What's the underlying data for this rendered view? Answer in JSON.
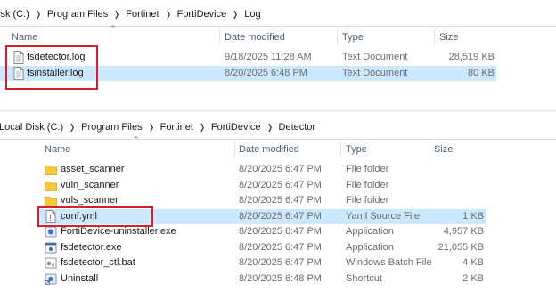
{
  "pane1": {
    "breadcrumb": [
      "isk (C:)",
      "Program Files",
      "Fortinet",
      "FortiDevice",
      "Log"
    ],
    "columns": {
      "name": "Name",
      "date": "Date modified",
      "type": "Type",
      "size": "Size"
    },
    "files": [
      {
        "name": "fsdetector.log",
        "date": "9/18/2025 11:28 AM",
        "type": "Text Document",
        "size": "28,519 KB",
        "icon": "text-file-icon"
      },
      {
        "name": "fsinstaller.log",
        "date": "8/20/2025 6:48 PM",
        "type": "Text Document",
        "size": "80 KB",
        "icon": "text-file-icon"
      }
    ]
  },
  "pane2": {
    "breadcrumb": [
      "Local Disk (C:)",
      "Program Files",
      "Fortinet",
      "FortiDevice",
      "Detector"
    ],
    "columns": {
      "name": "Name",
      "date": "Date modified",
      "type": "Type",
      "size": "Size"
    },
    "files": [
      {
        "name": "asset_scanner",
        "date": "8/20/2025 6:47 PM",
        "type": "File folder",
        "size": "",
        "icon": "folder-icon"
      },
      {
        "name": "vuln_scanner",
        "date": "8/20/2025 6:47 PM",
        "type": "File folder",
        "size": "",
        "icon": "folder-icon"
      },
      {
        "name": "vuls_scanner",
        "date": "8/20/2025 6:47 PM",
        "type": "File folder",
        "size": "",
        "icon": "folder-icon"
      },
      {
        "name": "conf.yml",
        "date": "8/20/2025 6:47 PM",
        "type": "Yaml Source File",
        "size": "1 KB",
        "icon": "yaml-file-icon"
      },
      {
        "name": "FortiDevice-uninstaller.exe",
        "date": "8/20/2025 6:47 PM",
        "type": "Application",
        "size": "4,957 KB",
        "icon": "uninstaller-app-icon"
      },
      {
        "name": "fsdetector.exe",
        "date": "8/20/2025 6:47 PM",
        "type": "Application",
        "size": "21,055 KB",
        "icon": "app-icon"
      },
      {
        "name": "fsdetector_ctl.bat",
        "date": "8/20/2025 6:47 PM",
        "type": "Windows Batch File",
        "size": "4 KB",
        "icon": "batch-file-icon"
      },
      {
        "name": "Uninstall",
        "date": "8/20/2025 6:48 PM",
        "type": "Shortcut",
        "size": "2 KB",
        "icon": "shortcut-icon"
      }
    ]
  },
  "colors": {
    "selection": "#cce8ff",
    "highlight_box": "#d4202a",
    "folder": "#f5c83f"
  }
}
